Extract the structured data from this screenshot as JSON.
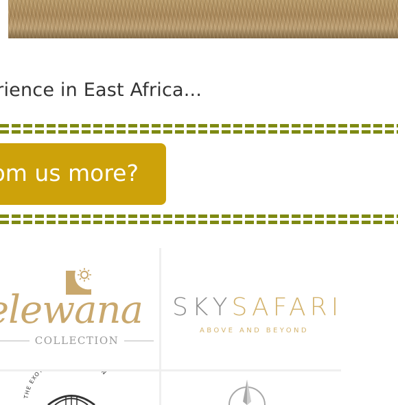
{
  "hero": {
    "image_label": "safari-grassland-photo"
  },
  "intro": {
    "teaser": "perience in East Africa..."
  },
  "cta": {
    "label": "om us more?",
    "color": "#cda20a"
  },
  "dividers": {
    "color": "#7e8a13"
  },
  "partners": {
    "elewana": {
      "name": "elewana",
      "subtitle": "COLLECTION"
    },
    "skysafari": {
      "name_part1": "SKY",
      "name_part2": "SAFARI",
      "tagline": "ABOVE AND BEYOND"
    },
    "amazon": {
      "ring_text": "THE EXOTIC AMAZON · GET IN"
    },
    "compass": {}
  }
}
